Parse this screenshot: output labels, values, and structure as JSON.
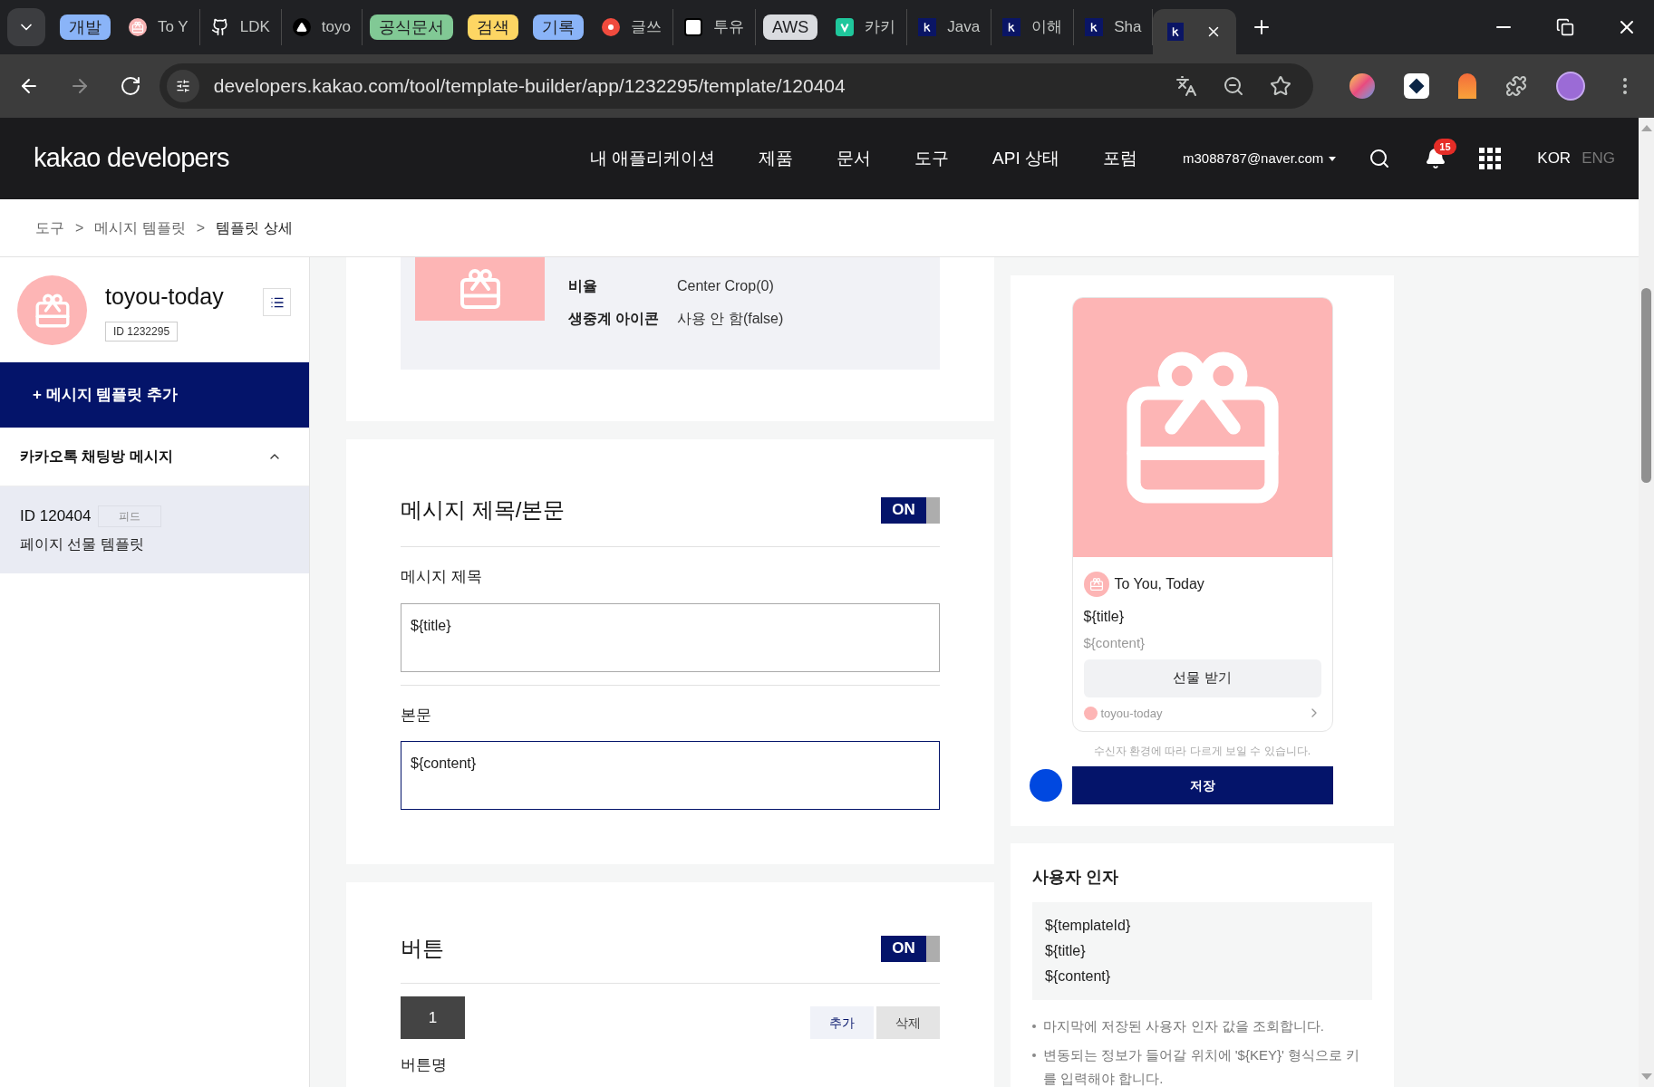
{
  "browser": {
    "tabs": [
      {
        "kind": "group",
        "label": "개발",
        "color": "#8ab4f8"
      },
      {
        "kind": "page",
        "label": "To Y",
        "selected": false
      },
      {
        "kind": "page",
        "label": "LDK",
        "selected": false
      },
      {
        "kind": "page",
        "label": "toyo",
        "selected": false
      },
      {
        "kind": "group",
        "label": "공식문서",
        "color": "#81c995"
      },
      {
        "kind": "group",
        "label": "검색",
        "color": "#fdd663"
      },
      {
        "kind": "group",
        "label": "기록",
        "color": "#8ab4f8"
      },
      {
        "kind": "page",
        "label": "글쓰",
        "selected": false
      },
      {
        "kind": "page",
        "label": "투유",
        "selected": false
      },
      {
        "kind": "group",
        "label": "AWS",
        "color": "#dadce0"
      },
      {
        "kind": "page",
        "label": "카키",
        "selected": false
      },
      {
        "kind": "page",
        "label": "Java",
        "selected": false
      },
      {
        "kind": "page",
        "label": "이해",
        "selected": false
      },
      {
        "kind": "page",
        "label": "Sha",
        "selected": false
      },
      {
        "kind": "page",
        "selected": true
      }
    ],
    "url": "developers.kakao.com/tool/template-builder/app/1232295/template/120404"
  },
  "header": {
    "logo": "kakao developers",
    "nav": [
      "내 애플리케이션",
      "제품",
      "문서",
      "도구",
      "API 상태",
      "포럼"
    ],
    "account": "m3088787@naver.com",
    "notifications": "15",
    "languages": [
      {
        "label": "KOR",
        "selected": true
      },
      {
        "label": "ENG",
        "selected": false
      }
    ]
  },
  "breadcrumb": {
    "items": [
      "도구",
      "메시지 템플릿",
      "템플릿 상세"
    ],
    "separator": ">"
  },
  "sidebar": {
    "app_name": "toyou-today",
    "app_id": "ID 1232295",
    "add_button": "+ 메시지 템플릿 추가",
    "section": {
      "title": "카카오톡 채팅방 메시지",
      "expanded": true
    },
    "templates": [
      {
        "id": "ID 120404",
        "type": "피드",
        "name": "페이지 선물 템플릿",
        "selected": true
      }
    ]
  },
  "image_info": {
    "rows": [
      {
        "label": "비율",
        "value": "Center Crop(0)"
      },
      {
        "label": "생중계 아이콘",
        "value": "사용 안 함(false)"
      }
    ]
  },
  "message_section": {
    "title": "메시지 제목/본문",
    "toggle": {
      "label": "ON",
      "on": true
    },
    "fields": [
      {
        "label": "메시지 제목",
        "value": "${title}",
        "focused": false
      },
      {
        "label": "본문",
        "value": "${content}",
        "focused": true
      }
    ]
  },
  "button_section": {
    "title": "버튼",
    "toggle": {
      "label": "ON",
      "on": true
    },
    "button_tabs": [
      {
        "label": "1",
        "selected": true
      }
    ],
    "actions": [
      "추가",
      "삭제"
    ],
    "field_label": "버튼명"
  },
  "preview": {
    "channel": "To You, Today",
    "title": "${title}",
    "content": "${content}",
    "button": "선물 받기",
    "footer": "toyou-today",
    "note": "수신자 환경에 따라 다르게 보일 수 있습니다.",
    "save": "저장"
  },
  "user_args": {
    "title": "사용자 인자",
    "args": [
      "${templateId}",
      "${title}",
      "${content}"
    ],
    "notes": [
      "마지막에 저장된 사용자 인자 값을 조회합니다.",
      "변동되는 정보가 들어갈 위치에 '${KEY}' 형식으로 키를 입력해야 합니다."
    ]
  }
}
